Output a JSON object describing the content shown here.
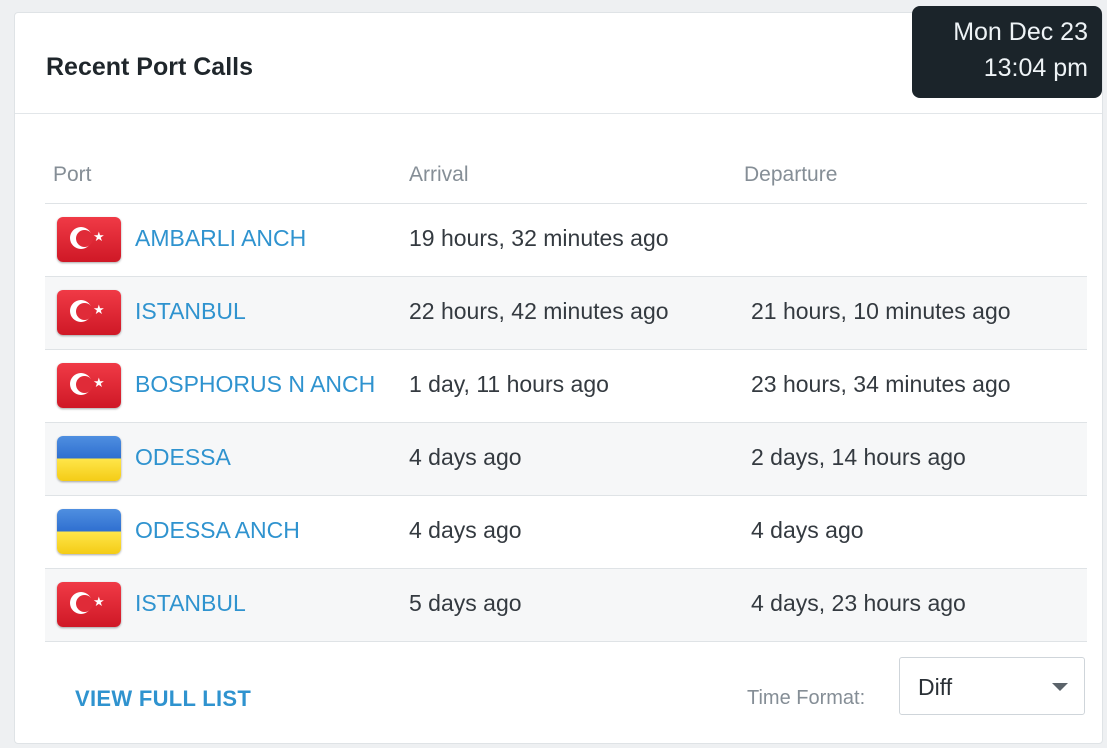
{
  "card": {
    "title": "Recent Port Calls"
  },
  "clock": {
    "date": "Mon Dec 23",
    "time": "13:04 pm"
  },
  "table": {
    "headers": {
      "port": "Port",
      "arrival": "Arrival",
      "departure": "Departure"
    },
    "rows": [
      {
        "flag": "turkey-flag-icon",
        "port": "AMBARLI ANCH",
        "arrival": "19 hours, 32 minutes ago",
        "departure": ""
      },
      {
        "flag": "turkey-flag-icon",
        "port": "ISTANBUL",
        "arrival": "22 hours, 42 minutes ago",
        "departure": "21 hours, 10 minutes ago"
      },
      {
        "flag": "turkey-flag-icon",
        "port": "BOSPHORUS N ANCH",
        "arrival": "1 day, 11 hours ago",
        "departure": "23 hours, 34 minutes ago"
      },
      {
        "flag": "ukraine-flag-icon",
        "port": "ODESSA",
        "arrival": "4 days ago",
        "departure": "2 days, 14 hours ago"
      },
      {
        "flag": "ukraine-flag-icon",
        "port": "ODESSA ANCH",
        "arrival": "4 days ago",
        "departure": "4 days ago"
      },
      {
        "flag": "turkey-flag-icon",
        "port": "ISTANBUL",
        "arrival": "5 days ago",
        "departure": "4 days, 23 hours ago"
      }
    ]
  },
  "footer": {
    "view_full_list": "VIEW FULL LIST",
    "time_format_label": "Time Format:",
    "time_format_value": "Diff"
  },
  "colors": {
    "link": "#2f93cf",
    "clock_bg": "#1b242a",
    "turkey_red": "#e02b38",
    "ukraine_blue": "#3b7fd8",
    "ukraine_yellow": "#f8d824"
  }
}
